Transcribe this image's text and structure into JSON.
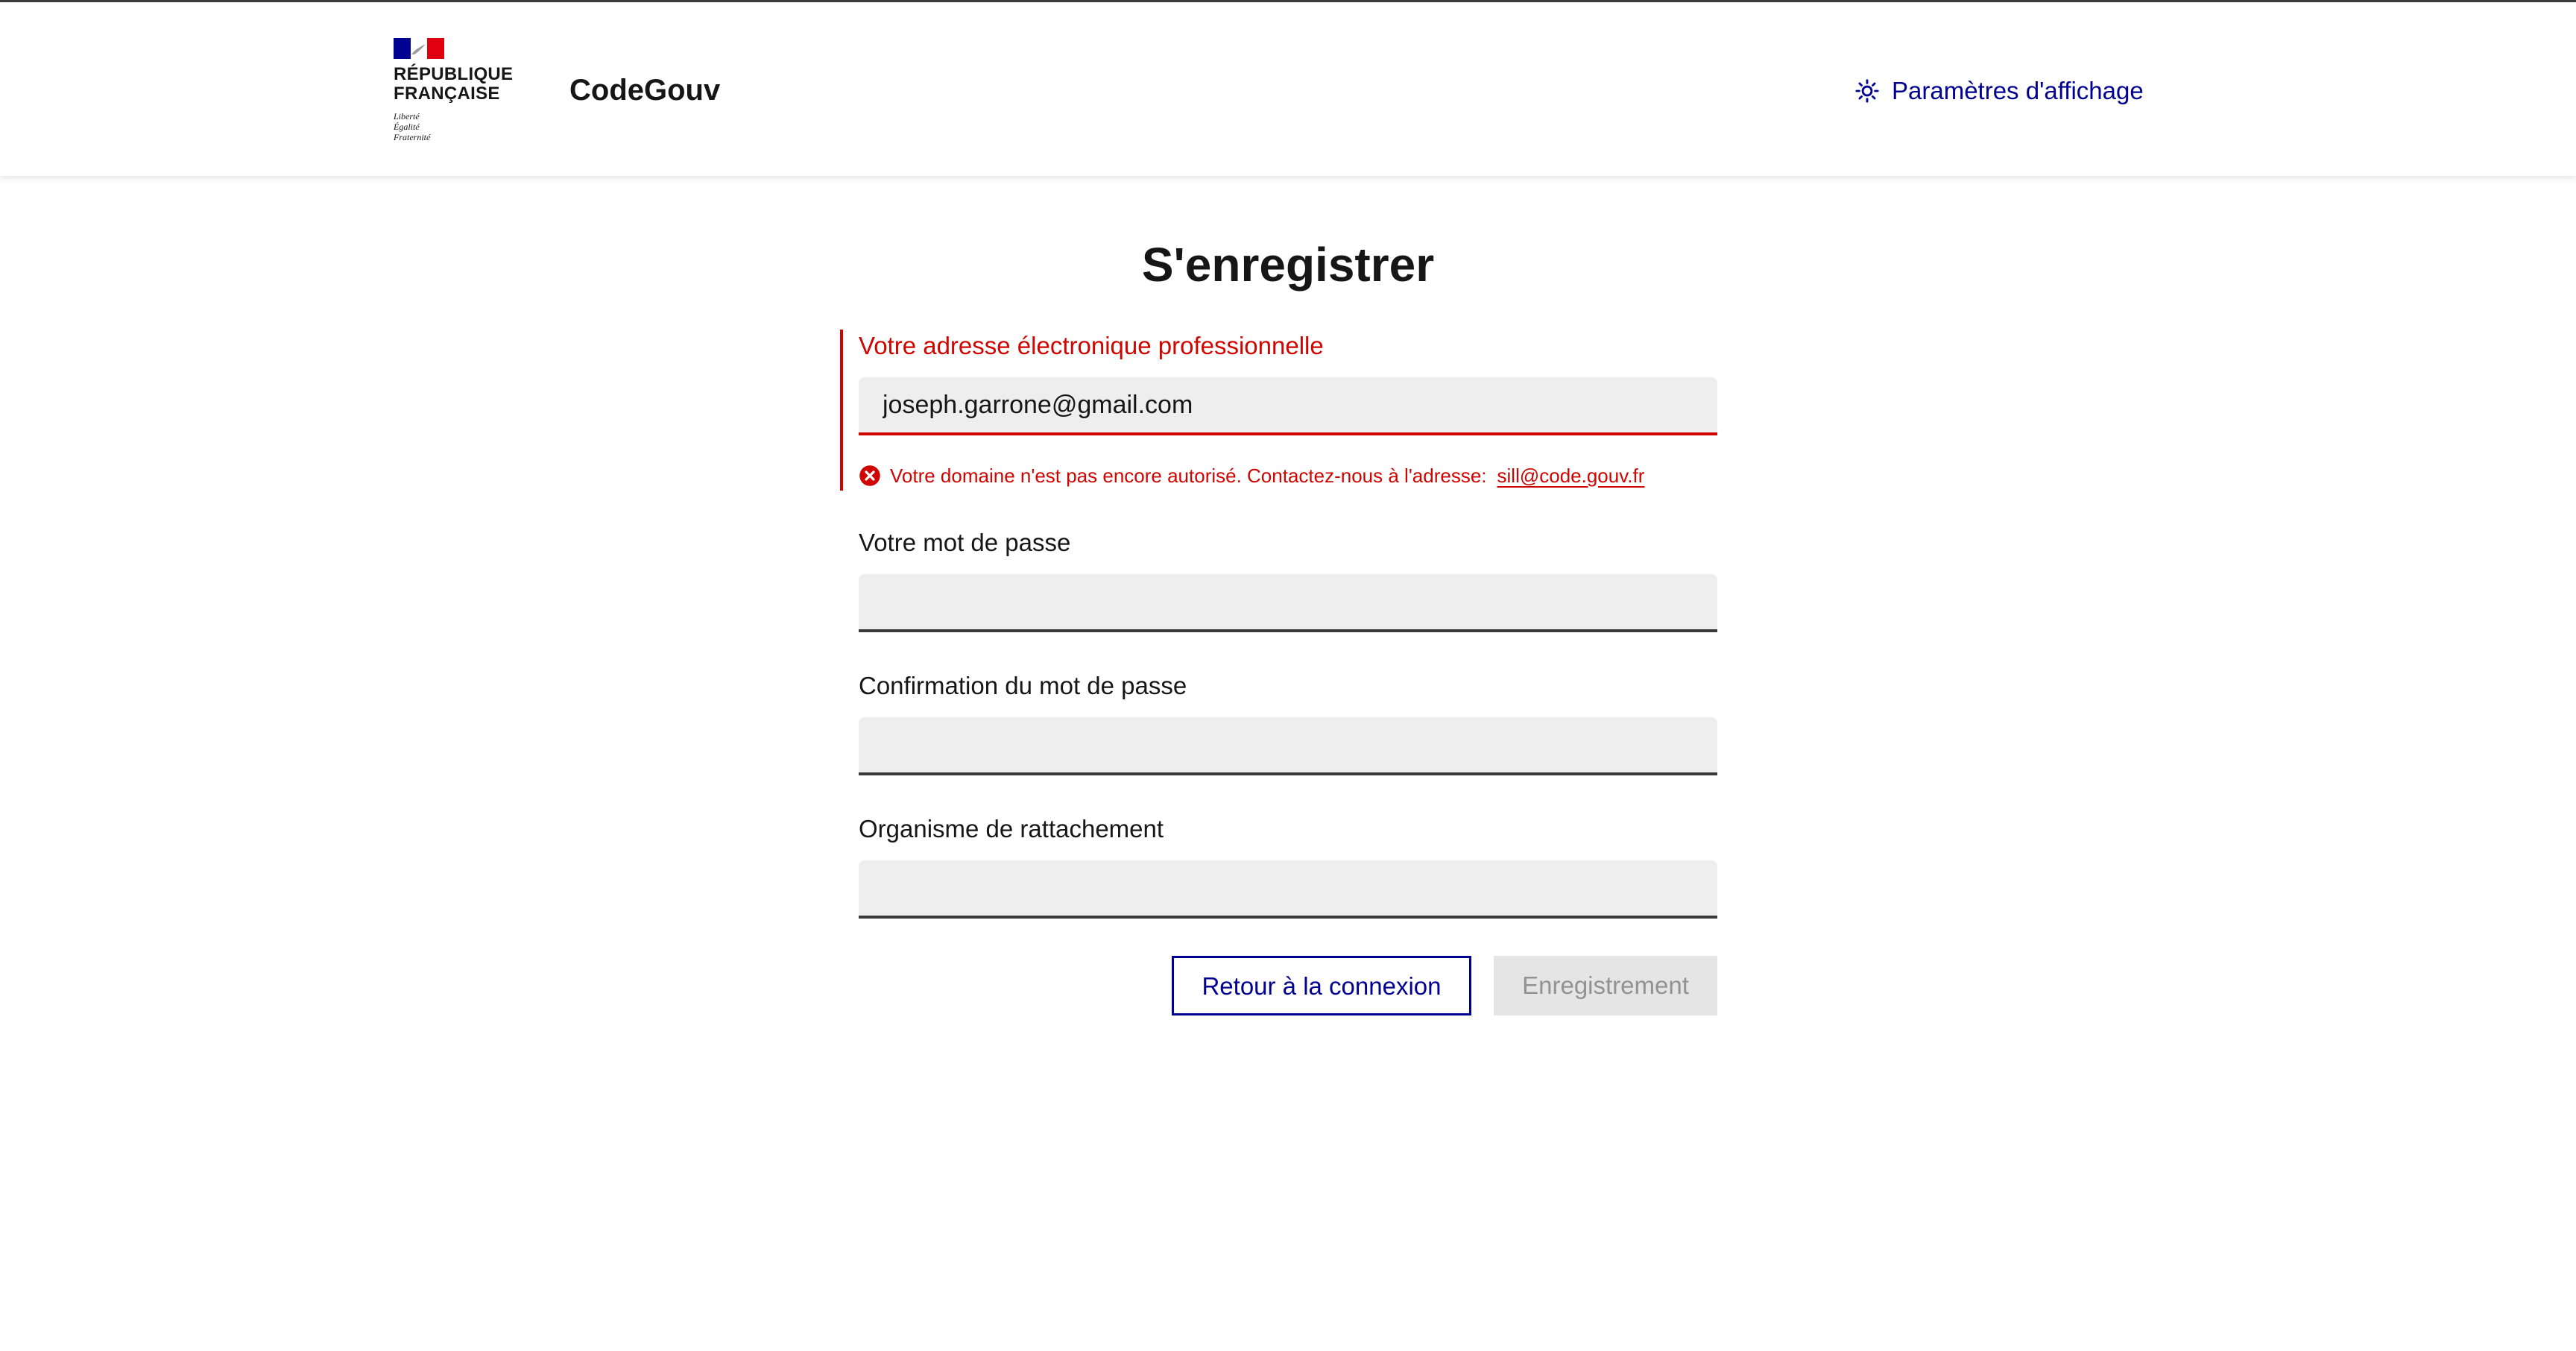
{
  "header": {
    "logo": {
      "marianne_lines": [
        "RÉPUBLIQUE",
        "FRANÇAISE"
      ],
      "devise_lines": [
        "Liberté",
        "Égalité",
        "Fraternité"
      ],
      "flag_colors": [
        "#000091",
        "#ffffff",
        "#e1000f"
      ]
    },
    "service_title": "CodeGouv",
    "display_settings": {
      "label": "Paramètres d'affichage",
      "icon": "sun-icon"
    }
  },
  "main": {
    "title": "S'enregistrer",
    "fields": [
      {
        "label": "Votre adresse électronique professionnelle",
        "value": "joseph.garrone@gmail.com",
        "state": "error",
        "error": {
          "icon": "error-circle-icon",
          "text": "Votre domaine n'est pas encore autorisé. Contactez-nous à l'adresse:",
          "link": "sill@code.gouv.fr"
        }
      },
      {
        "label": "Votre mot de passe",
        "value": ""
      },
      {
        "label": "Confirmation du mot de passe",
        "value": ""
      },
      {
        "label": "Organisme de rattachement",
        "value": ""
      }
    ],
    "buttons": {
      "back": "Retour à la connexion",
      "submit": "Enregistrement"
    }
  },
  "colors": {
    "accent": "#000091",
    "error": "#ce0500",
    "input_background": "#eeeeee",
    "disabled_background": "#e5e5e5",
    "disabled_text": "#929292"
  }
}
